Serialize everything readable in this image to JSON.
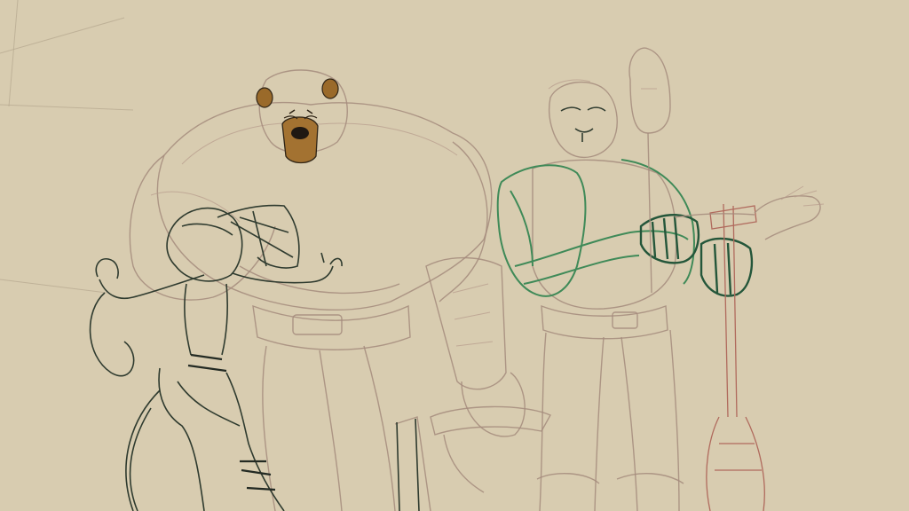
{
  "scene": {
    "palette": {
      "paper": "#d8ccb0",
      "rough_sketch": "#a48b7d",
      "ink": "#2f3b2f",
      "green_lineart": "#3f8a58",
      "bear_fur": "#9a6a2a",
      "tool_red": "#b06a5d"
    },
    "subjects": [
      {
        "name": "bear-figure"
      },
      {
        "name": "lion-figure"
      },
      {
        "name": "small-figure"
      }
    ]
  }
}
